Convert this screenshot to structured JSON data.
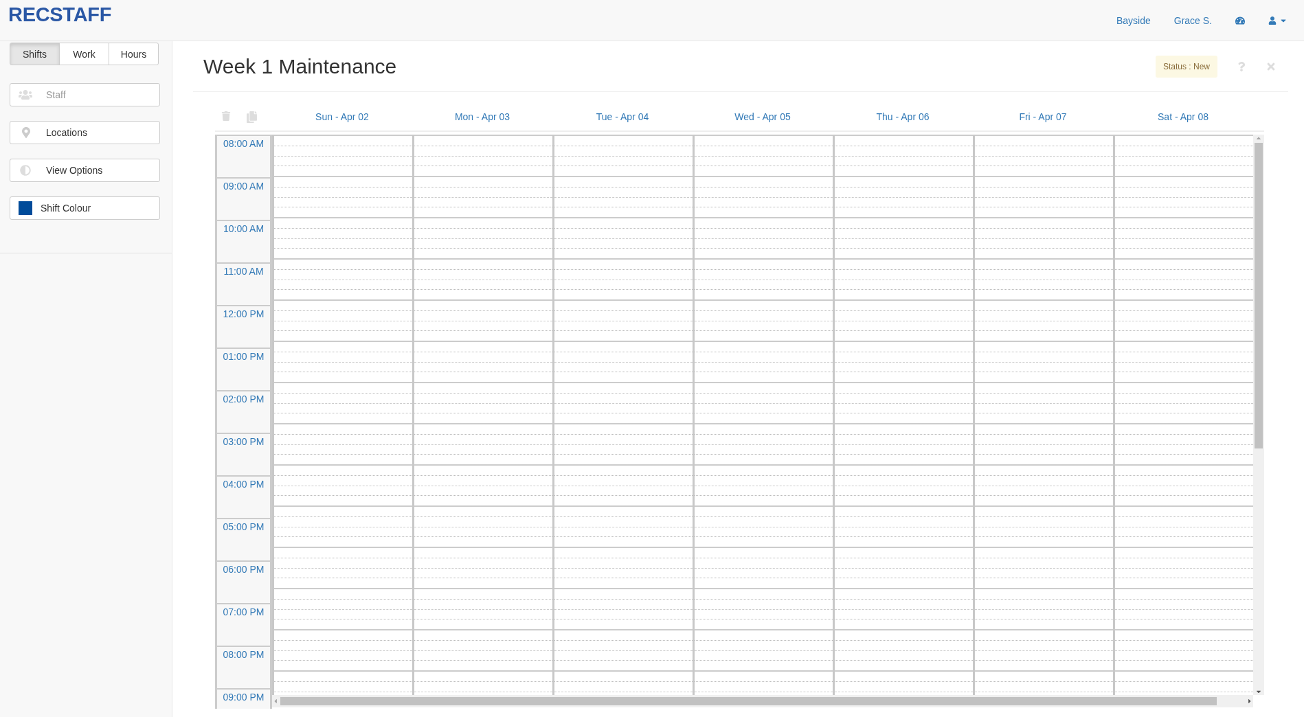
{
  "header": {
    "logo": "RECSTAFF",
    "links": [
      "Bayside",
      "Grace S."
    ]
  },
  "sidebar": {
    "tabs": [
      {
        "label": "Shifts",
        "selected": true
      },
      {
        "label": "Work",
        "selected": false
      },
      {
        "label": "Hours",
        "selected": false
      }
    ],
    "buttons": [
      {
        "kind": "staff",
        "label": "Staff",
        "disabled": true
      },
      {
        "kind": "location",
        "label": "Locations",
        "disabled": false
      },
      {
        "kind": "options",
        "label": "View Options",
        "disabled": false
      },
      {
        "kind": "colour",
        "label": "Shift Colour",
        "disabled": false,
        "color": "#004b9a"
      }
    ]
  },
  "schedule": {
    "title": "Week 1 Maintenance",
    "status": "Status : New",
    "days": [
      "Sun - Apr 02",
      "Mon - Apr 03",
      "Tue - Apr 04",
      "Wed - Apr 05",
      "Thu - Apr 06",
      "Fri - Apr 07",
      "Sat - Apr 08"
    ],
    "times": [
      "08:00 AM",
      "09:00 AM",
      "10:00 AM",
      "11:00 AM",
      "12:00 PM",
      "01:00 PM",
      "02:00 PM",
      "03:00 PM",
      "04:00 PM",
      "05:00 PM",
      "06:00 PM",
      "07:00 PM",
      "08:00 PM",
      "09:00 PM"
    ]
  }
}
